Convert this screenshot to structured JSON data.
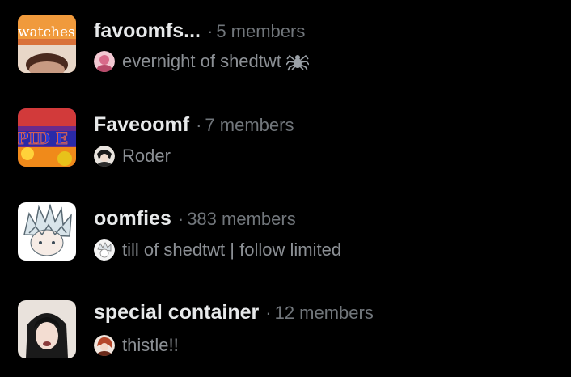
{
  "groups": [
    {
      "name": "favoomfs...",
      "separator": "·",
      "members": "5 members",
      "thumb_text": "watches",
      "last_message_author": "evernight of shedtwt",
      "author_emoji": "spider-icon"
    },
    {
      "name": "Faveoomf",
      "separator": "·",
      "members": "7 members",
      "thumb_text": "PID E",
      "last_message_author": "Roder"
    },
    {
      "name": "oomfies",
      "separator": "·",
      "members": "383 members",
      "last_message_author": "till of shedtwt | follow limited"
    },
    {
      "name": "special container",
      "separator": "·",
      "members": "12 members",
      "last_message_author": "thistle!!"
    }
  ],
  "colors": {
    "background": "#000000",
    "primary_text": "#e7e9ea",
    "secondary_text": "#71767b"
  }
}
